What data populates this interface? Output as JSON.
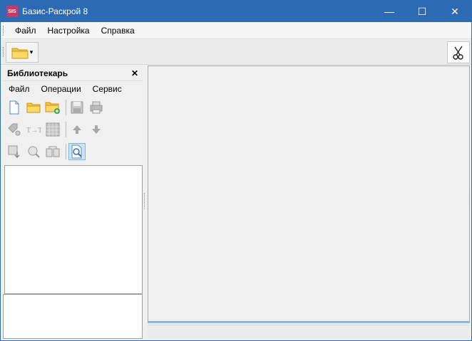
{
  "window": {
    "title": "Базис-Раскрой 8",
    "app_icon_text": "SIS",
    "controls": {
      "minimize": "—",
      "maximize": "☐",
      "close": "✕"
    }
  },
  "menubar": {
    "items": [
      {
        "label": "Файл"
      },
      {
        "label": "Настройка"
      },
      {
        "label": "Справка"
      }
    ]
  },
  "toolbar": {
    "open_icon": "folder-icon",
    "dropdown_arrow": "▾",
    "cut_icon": "scissors-icon"
  },
  "librarian": {
    "title": "Библиотекарь",
    "close": "✕",
    "menu": [
      {
        "label": "Файл"
      },
      {
        "label": "Операции"
      },
      {
        "label": "Сервис"
      }
    ],
    "active_icon": "search-document-icon"
  },
  "colors": {
    "titlebar": "#2c6bb4",
    "accent_line": "#6ec5f0",
    "active_tool": "#cde6f7"
  }
}
